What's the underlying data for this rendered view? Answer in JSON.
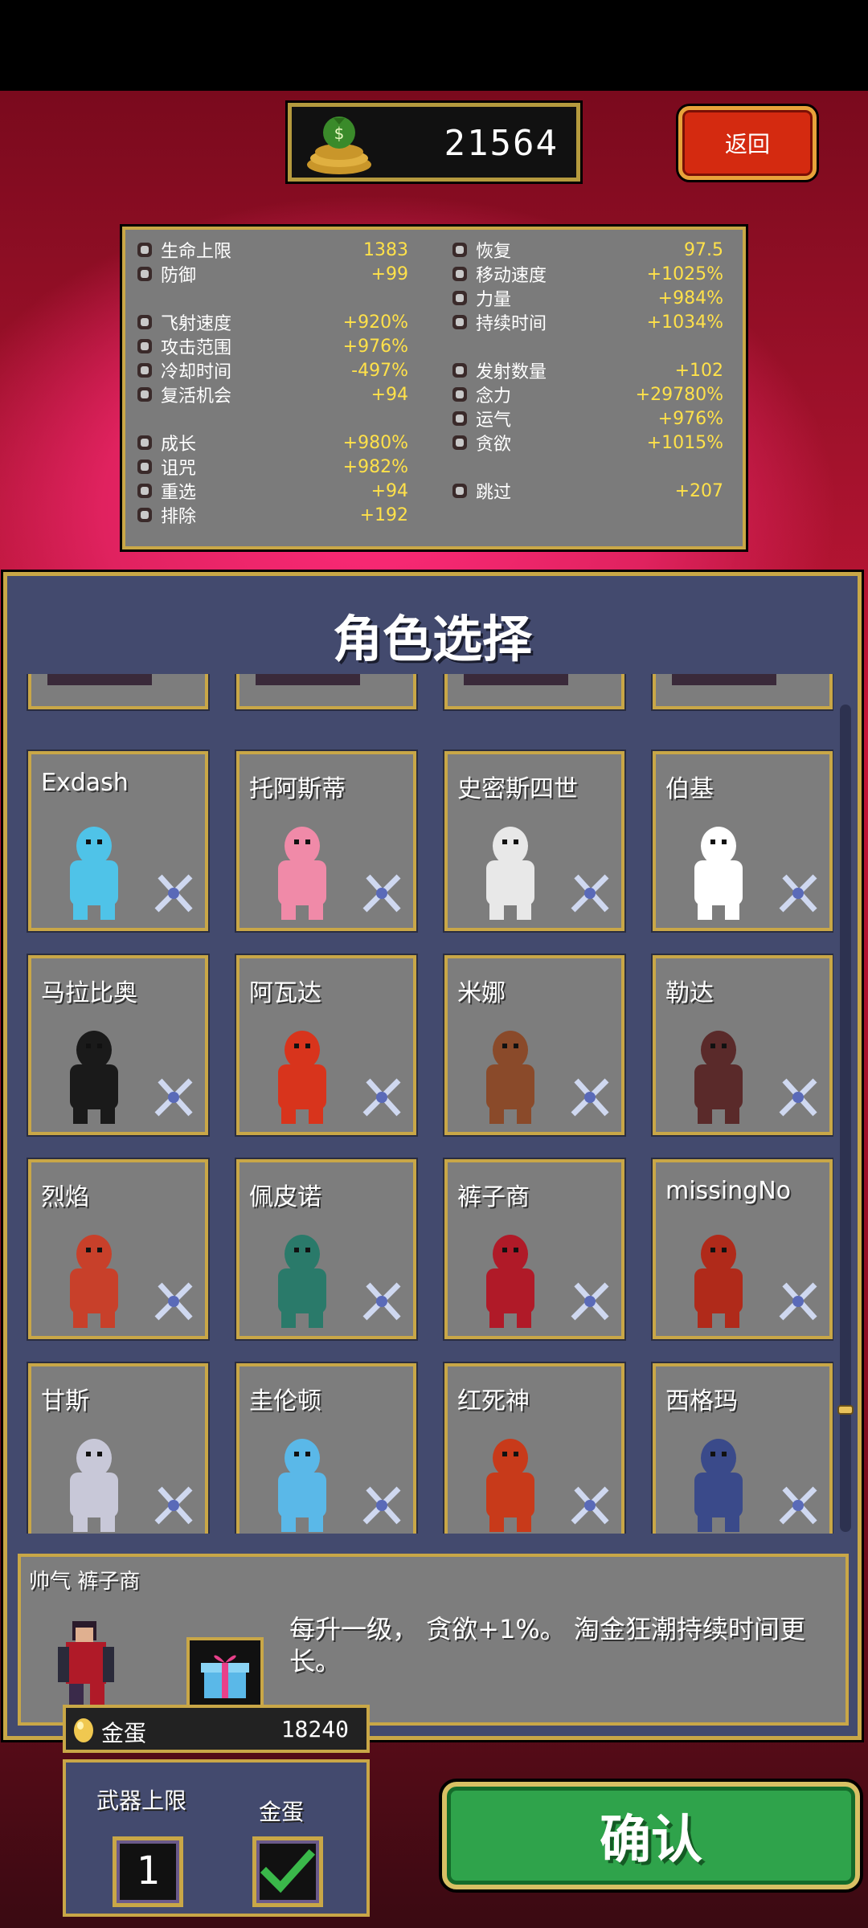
{
  "header": {
    "gold": "21564",
    "back_label": "返回"
  },
  "stats": {
    "left": [
      {
        "name": "生命上限",
        "value": "1383",
        "icon": "heart-icon"
      },
      {
        "name": "防御",
        "value": "+99",
        "icon": "armor-icon"
      },
      {
        "name": "飞射速度",
        "value": "+920%",
        "icon": "speed-icon"
      },
      {
        "name": "攻击范围",
        "value": "+976%",
        "icon": "area-icon"
      },
      {
        "name": "冷却时间",
        "value": "-497%",
        "icon": "cooldown-icon"
      },
      {
        "name": "复活机会",
        "value": "+94",
        "icon": "revival-icon"
      },
      {
        "name": "成长",
        "value": "+980%",
        "icon": "growth-icon"
      },
      {
        "name": "诅咒",
        "value": "+982%",
        "icon": "curse-icon"
      },
      {
        "name": "重选",
        "value": "+94",
        "icon": "reroll-icon"
      },
      {
        "name": "排除",
        "value": "+192",
        "icon": "banish-icon"
      }
    ],
    "right": [
      {
        "name": "恢复",
        "value": "97.5",
        "icon": "recovery-icon"
      },
      {
        "name": "移动速度",
        "value": "+1025%",
        "icon": "wing-icon"
      },
      {
        "name": "力量",
        "value": "+984%",
        "icon": "might-icon"
      },
      {
        "name": "持续时间",
        "value": "+1034%",
        "icon": "duration-icon"
      },
      {
        "name": "发射数量",
        "value": "+102",
        "icon": "amount-icon"
      },
      {
        "name": "念力",
        "value": "+29780%",
        "icon": "magnet-icon"
      },
      {
        "name": "运气",
        "value": "+976%",
        "icon": "clover-icon"
      },
      {
        "name": "贪欲",
        "value": "+1015%",
        "icon": "greed-icon"
      },
      {
        "name": "跳过",
        "value": "+207",
        "icon": "skip-icon"
      }
    ]
  },
  "panel_title": "角色选择",
  "characters": [
    {
      "name": "Exdash",
      "color": "#4fc3e8"
    },
    {
      "name": "托阿斯蒂",
      "color": "#f08aa8"
    },
    {
      "name": "史密斯四世",
      "color": "#e8e8e8"
    },
    {
      "name": "伯基",
      "color": "#ffffff"
    },
    {
      "name": "马拉比奥",
      "color": "#1a1a1a"
    },
    {
      "name": "阿瓦达",
      "color": "#d8341c"
    },
    {
      "name": "米娜",
      "color": "#8a4a2a"
    },
    {
      "name": "勒达",
      "color": "#5a2a2a"
    },
    {
      "name": "烈焰",
      "color": "#c8402a"
    },
    {
      "name": "佩皮诺",
      "color": "#2a7a6a"
    },
    {
      "name": "裤子商",
      "color": "#b01a28"
    },
    {
      "name": "missingNo",
      "color": "#b02a1a"
    },
    {
      "name": "甘斯",
      "color": "#c8c8d8"
    },
    {
      "name": "圭伦顿",
      "color": "#5ab8e8"
    },
    {
      "name": "红死神",
      "color": "#c83a1a"
    },
    {
      "name": "西格玛",
      "color": "#3a4a8a"
    }
  ],
  "selected": {
    "name": "帅气 裤子商",
    "description": "每升一级， 贪欲+1%。 淘金狂潮持续时间更长。"
  },
  "golden_egg": {
    "label": "金蛋",
    "value": "18240"
  },
  "options": {
    "weapon_limit_label": "武器上限",
    "weapon_limit_value": "1",
    "golden_egg_label": "金蛋"
  },
  "confirm_label": "确认"
}
